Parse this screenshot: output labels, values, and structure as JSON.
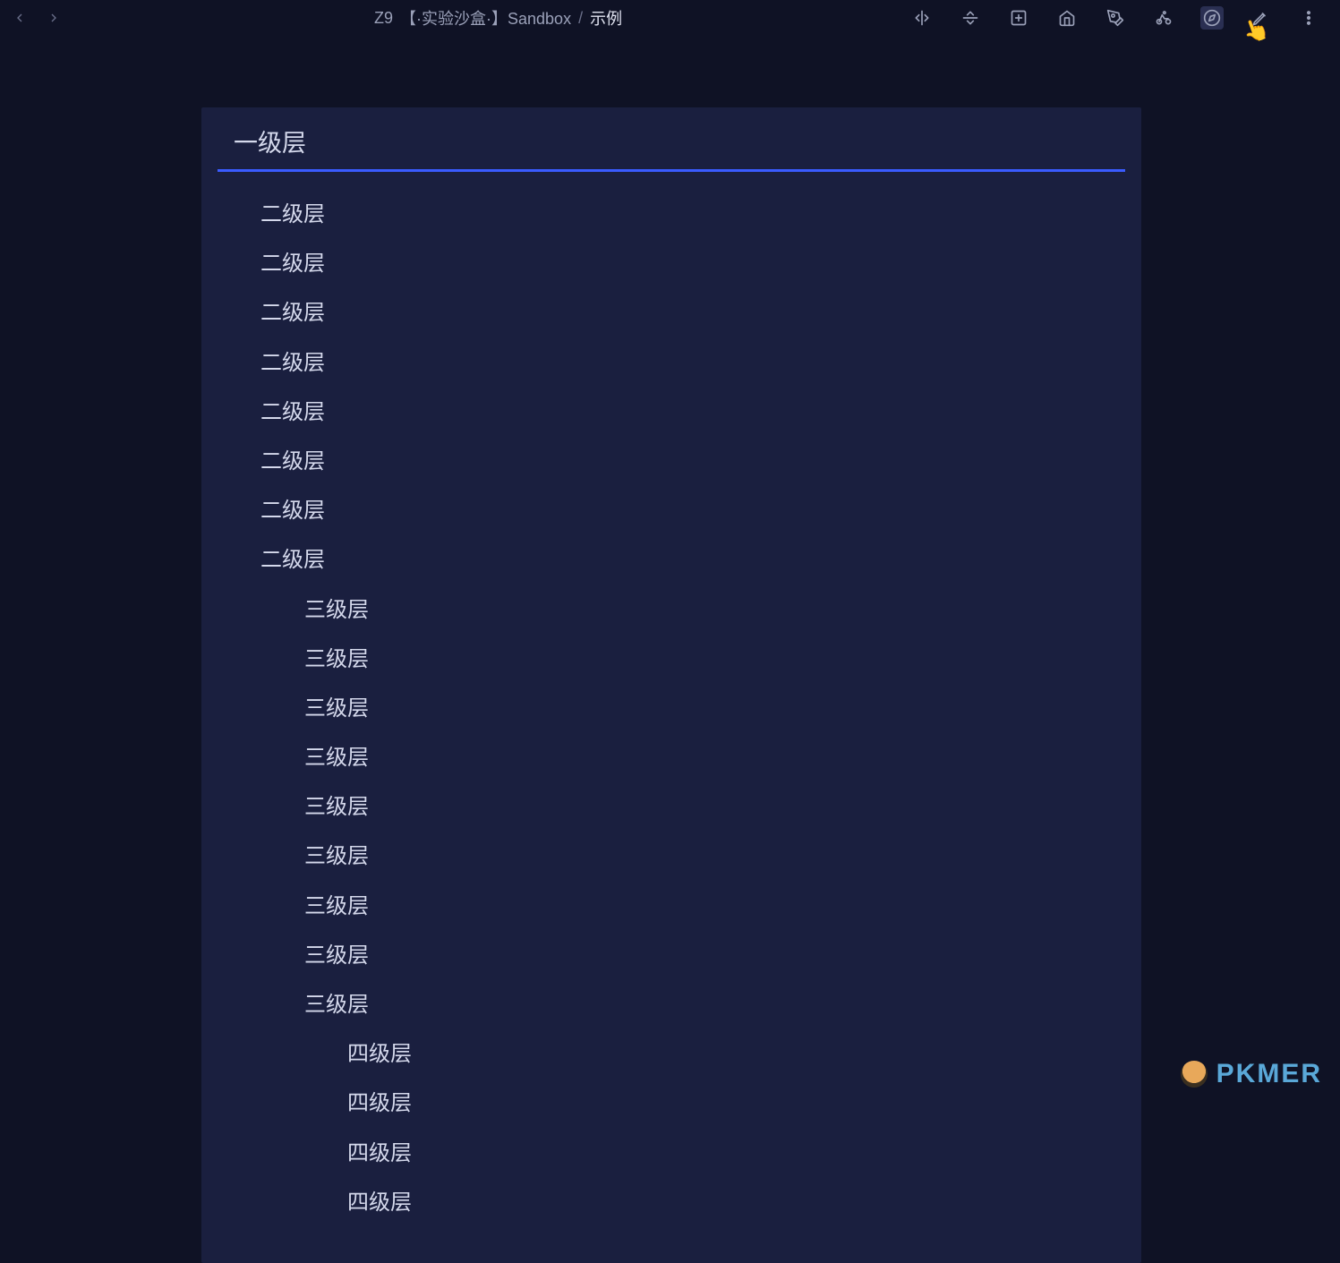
{
  "breadcrumb": {
    "prefix": "Z9",
    "folder": "【·实验沙盒·】Sandbox",
    "sep": "/",
    "current": "示例"
  },
  "outline": {
    "level1": "一级层",
    "level2_label": "二级层",
    "level3_label": "三级层",
    "level4_label": "四级层",
    "level2_count": 8,
    "level3_count": 9,
    "level4_count": 4
  },
  "watermark": {
    "text": "PKMER"
  },
  "icons": {
    "back": "back-arrow",
    "forward": "forward-arrow",
    "split_h": "split-horizontal",
    "split_v": "split-vertical",
    "add": "add-square",
    "home": "home",
    "pen": "pen",
    "bike": "bike",
    "compass": "compass",
    "edit": "edit-line",
    "more": "more"
  }
}
